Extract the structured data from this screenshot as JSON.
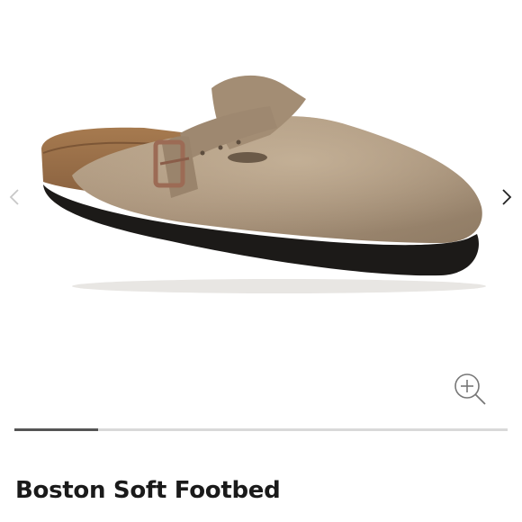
{
  "product": {
    "title": "Boston Soft Footbed"
  },
  "gallery": {
    "image_subject": "tan oiled leather clog with buckle strap, cork footbed and black sole",
    "prev_icon": "chevron-left-icon",
    "next_icon": "chevron-right-icon",
    "zoom_icon": "zoom-in-icon",
    "progress": 0.17
  },
  "colors": {
    "arrow_prev": "#c8c8c8",
    "arrow_next": "#222222",
    "progress_track": "#d9d9d9",
    "progress_fill": "#555555",
    "title": "#1a1a1a"
  }
}
